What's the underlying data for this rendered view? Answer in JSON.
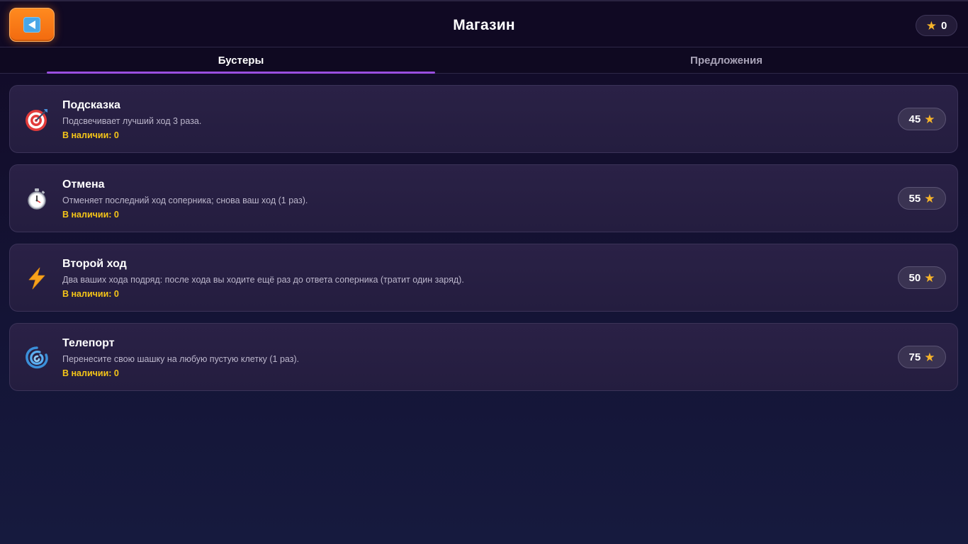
{
  "header": {
    "title": "Магазин",
    "stars_count": "0"
  },
  "tabs": [
    {
      "label": "Бустеры",
      "active": true
    },
    {
      "label": "Предложения",
      "active": false
    }
  ],
  "boosters": [
    {
      "icon": "target-icon",
      "title": "Подсказка",
      "description": "Подсвечивает лучший ход 3 раза.",
      "stock": "В наличии: 0",
      "price": "45"
    },
    {
      "icon": "stopwatch-icon",
      "title": "Отмена",
      "description": "Отменяет последний ход соперника; снова ваш ход (1 раз).",
      "stock": "В наличии: 0",
      "price": "55"
    },
    {
      "icon": "lightning-icon",
      "title": "Второй ход",
      "description": "Два ваших хода подряд: после хода вы ходите ещё раз до ответа соперника (тратит один заряд).",
      "stock": "В наличии: 0",
      "price": "50"
    },
    {
      "icon": "cyclone-icon",
      "title": "Телепорт",
      "description": "Перенесите свою шашку на любую пустую клетку (1 раз).",
      "stock": "В наличии: 0",
      "price": "75"
    }
  ],
  "colors": {
    "accent": "#9a4fe0",
    "back_button": "#f26a0f",
    "star": "#f6b42a",
    "stock_text": "#f5c518"
  }
}
